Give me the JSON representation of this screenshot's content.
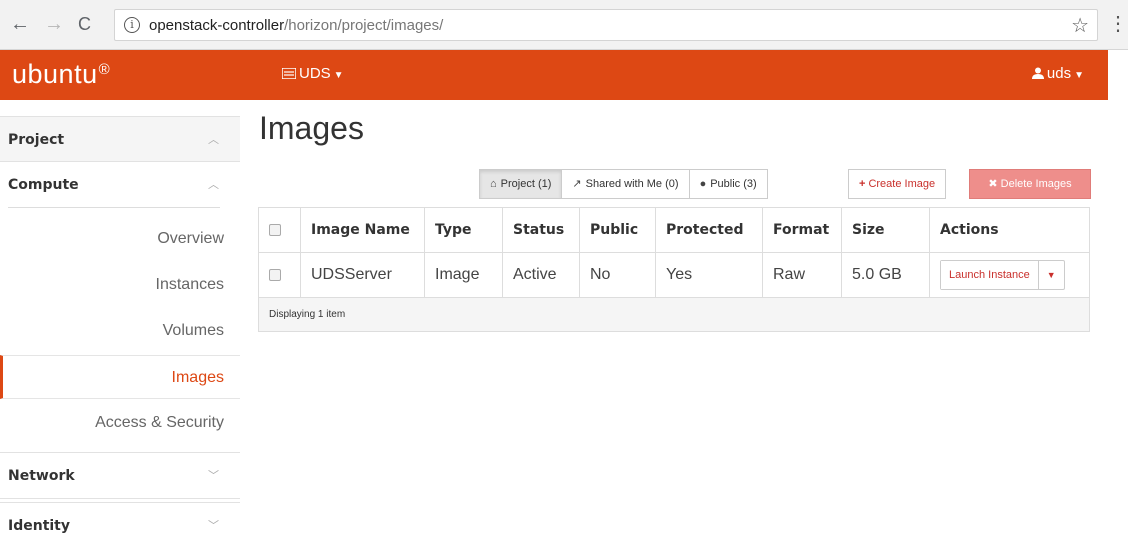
{
  "browser": {
    "back_icon": "←",
    "forward_icon": "→",
    "reload_icon": "C",
    "info_icon": "i",
    "url_host": "openstack-controller",
    "url_path": "/horizon/project/images/",
    "star_icon": "☆",
    "menu_icon": "⋮"
  },
  "header": {
    "brand": "ubuntu",
    "brand_mark": "®",
    "project_switcher": "UDS",
    "user": "uds",
    "colors": {
      "accent": "#dd4814"
    }
  },
  "sidebar": {
    "project_label": "Project",
    "compute_label": "Compute",
    "items": [
      {
        "label": "Overview"
      },
      {
        "label": "Instances"
      },
      {
        "label": "Volumes"
      },
      {
        "label": "Images"
      },
      {
        "label": "Access & Security"
      }
    ],
    "network_label": "Network",
    "identity_label": "Identity",
    "active_item": "Images"
  },
  "main": {
    "title": "Images",
    "filters": {
      "project": "Project (1)",
      "shared": "Shared with Me (0)",
      "public": "Public (3)"
    },
    "create_label": "Create Image",
    "delete_label": "Delete Images",
    "table": {
      "headers": [
        "Image Name",
        "Type",
        "Status",
        "Public",
        "Protected",
        "Format",
        "Size",
        "Actions"
      ],
      "rows": [
        {
          "name": "UDSServer",
          "type": "Image",
          "status": "Active",
          "public": "No",
          "protected": "Yes",
          "format": "Raw",
          "size": "5.0 GB",
          "action": "Launch Instance"
        }
      ],
      "footer": "Displaying 1 item"
    }
  }
}
